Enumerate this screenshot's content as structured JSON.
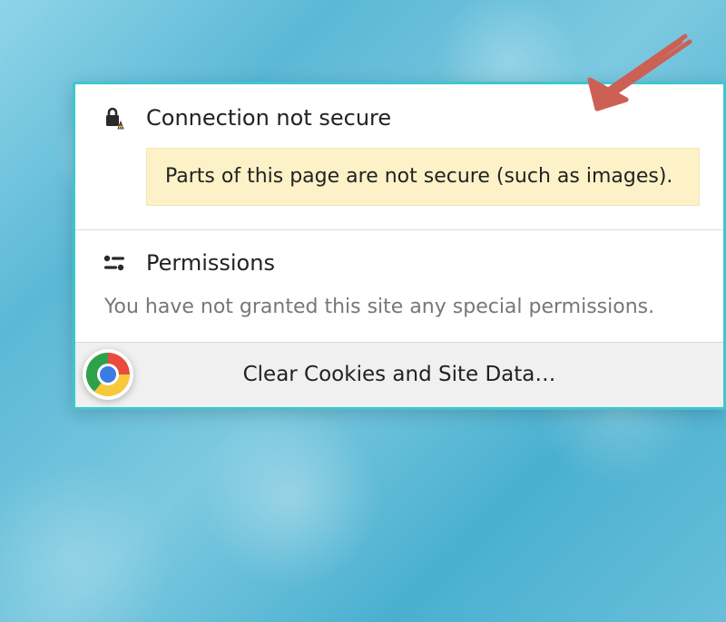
{
  "connection": {
    "title": "Connection not secure",
    "warning": "Parts of this page are not secure (such as images)."
  },
  "permissions": {
    "title": "Permissions",
    "message": "You have not granted this site any special permissions."
  },
  "clear": {
    "label": "Clear Cookies and Site Data…"
  },
  "icons": {
    "lock_warn": "lock-warning-icon",
    "permissions": "permissions-icon",
    "chrome": "chrome-icon",
    "arrow": "hand-drawn-arrow"
  },
  "colors": {
    "border": "#3ec7cf",
    "banner_bg": "#fdf2c7",
    "arrow": "#cc6055"
  }
}
